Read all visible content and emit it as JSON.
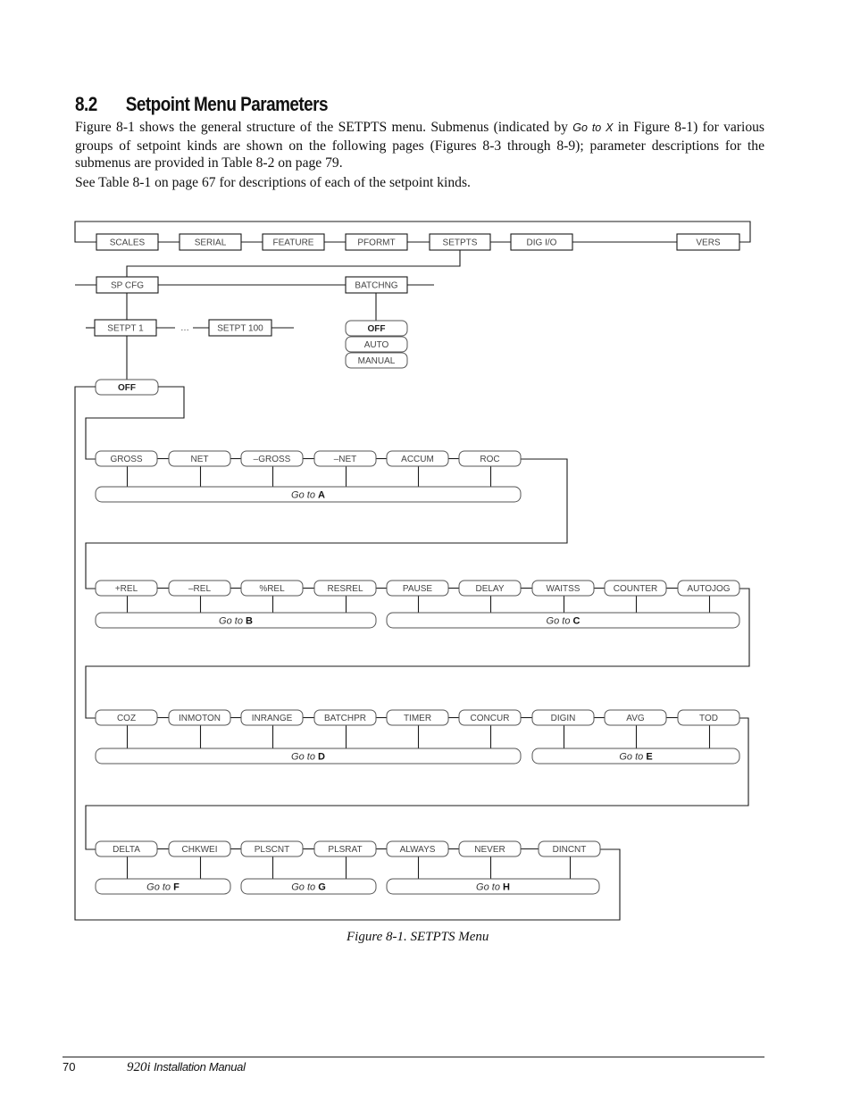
{
  "section": {
    "number": "8.2",
    "title": "Setpoint Menu Parameters"
  },
  "paragraphs": {
    "p1_before": "Figure 8-1 shows the general structure of the SETPTS menu. Submenus (indicated by ",
    "p1_goto": "Go to X",
    "p1_after": " in Figure 8-1) for various groups of setpoint kinds are shown on the following pages (Figures 8-3 through 8-9); parameter descriptions for the submenus are provided in Table 8-2 on page 79.",
    "p2": "See Table 8-1 on page 67 for descriptions of each of the setpoint kinds."
  },
  "diagram": {
    "top_menu": [
      "SCALES",
      "SERIAL",
      "FEATURE",
      "PFORMT",
      "SETPTS",
      "DIG I/O",
      "VERS"
    ],
    "setpts_submenu": [
      "SP CFG",
      "BATCHNG"
    ],
    "setpoints": [
      "SETPT 1",
      "SETPT 100"
    ],
    "ellipsis": "…",
    "batching_options": [
      "OFF",
      "AUTO",
      "MANUAL"
    ],
    "kind_default": "OFF",
    "goto_prefix": "Go to",
    "rows": [
      {
        "kinds": [
          "GROSS",
          "NET",
          "–GROSS",
          "–NET",
          "ACCUM",
          "ROC"
        ],
        "groups": [
          {
            "letter": "A",
            "kinds": [
              "GROSS",
              "NET",
              "–GROSS",
              "–NET",
              "ACCUM",
              "ROC"
            ]
          }
        ]
      },
      {
        "kinds": [
          "+REL",
          "–REL",
          "%REL",
          "RESREL",
          "PAUSE",
          "DELAY",
          "WAITSS",
          "COUNTER",
          "AUTOJOG"
        ],
        "groups": [
          {
            "letter": "B",
            "kinds": [
              "+REL",
              "–REL",
              "%REL",
              "RESREL"
            ]
          },
          {
            "letter": "C",
            "kinds": [
              "PAUSE",
              "DELAY",
              "WAITSS",
              "COUNTER",
              "AUTOJOG"
            ]
          }
        ]
      },
      {
        "kinds": [
          "COZ",
          "INMOTON",
          "INRANGE",
          "BATCHPR",
          "TIMER",
          "CONCUR",
          "DIGIN",
          "AVG",
          "TOD"
        ],
        "groups": [
          {
            "letter": "D",
            "kinds": [
              "COZ",
              "INMOTON",
              "INRANGE",
              "BATCHPR",
              "TIMER",
              "CONCUR"
            ]
          },
          {
            "letter": "E",
            "kinds": [
              "DIGIN",
              "AVG",
              "TOD"
            ]
          }
        ]
      },
      {
        "kinds": [
          "DELTA",
          "CHKWEI",
          "PLSCNT",
          "PLSRAT",
          "ALWAYS",
          "NEVER",
          "DINCNT"
        ],
        "groups": [
          {
            "letter": "F",
            "kinds": [
              "DELTA",
              "CHKWEI"
            ]
          },
          {
            "letter": "G",
            "kinds": [
              "PLSCNT",
              "PLSRAT"
            ]
          },
          {
            "letter": "H",
            "kinds": [
              "ALWAYS",
              "NEVER",
              "DINCNT"
            ]
          }
        ]
      }
    ]
  },
  "caption": "Figure 8-1. SETPTS Menu",
  "footer": {
    "page_number": "70",
    "product": "920i",
    "title": " Installation Manual"
  }
}
